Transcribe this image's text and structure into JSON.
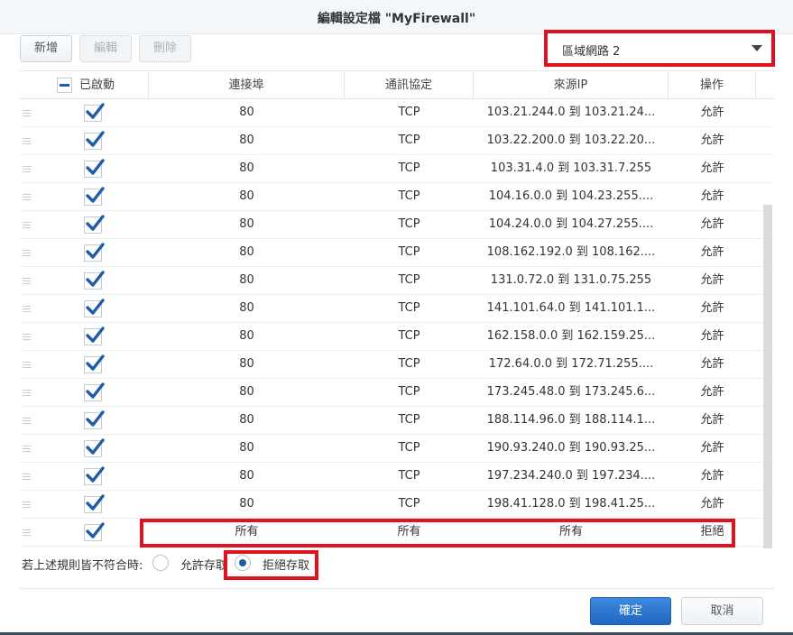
{
  "dialog": {
    "title": "編輯設定檔 \"MyFirewall\""
  },
  "toolbar": {
    "add_label": "新增",
    "edit_label": "編輯",
    "delete_label": "刪除"
  },
  "zone_select": {
    "value": "區域網路 2"
  },
  "columns": {
    "enabled": "已啟動",
    "port": "連接埠",
    "protocol": "通訊協定",
    "source_ip": "來源IP",
    "action": "操作"
  },
  "rules": [
    {
      "enabled": true,
      "port": "80",
      "protocol": "TCP",
      "source_ip": "103.21.244.0 到 103.21.24...",
      "action": "允許"
    },
    {
      "enabled": true,
      "port": "80",
      "protocol": "TCP",
      "source_ip": "103.22.200.0 到 103.22.20...",
      "action": "允許"
    },
    {
      "enabled": true,
      "port": "80",
      "protocol": "TCP",
      "source_ip": "103.31.4.0 到 103.31.7.255",
      "action": "允許"
    },
    {
      "enabled": true,
      "port": "80",
      "protocol": "TCP",
      "source_ip": "104.16.0.0 到 104.23.255....",
      "action": "允許"
    },
    {
      "enabled": true,
      "port": "80",
      "protocol": "TCP",
      "source_ip": "104.24.0.0 到 104.27.255....",
      "action": "允許"
    },
    {
      "enabled": true,
      "port": "80",
      "protocol": "TCP",
      "source_ip": "108.162.192.0 到 108.162....",
      "action": "允許"
    },
    {
      "enabled": true,
      "port": "80",
      "protocol": "TCP",
      "source_ip": "131.0.72.0 到 131.0.75.255",
      "action": "允許"
    },
    {
      "enabled": true,
      "port": "80",
      "protocol": "TCP",
      "source_ip": "141.101.64.0 到 141.101.1...",
      "action": "允許"
    },
    {
      "enabled": true,
      "port": "80",
      "protocol": "TCP",
      "source_ip": "162.158.0.0 到 162.159.25...",
      "action": "允許"
    },
    {
      "enabled": true,
      "port": "80",
      "protocol": "TCP",
      "source_ip": "172.64.0.0 到 172.71.255....",
      "action": "允許"
    },
    {
      "enabled": true,
      "port": "80",
      "protocol": "TCP",
      "source_ip": "173.245.48.0 到 173.245.6...",
      "action": "允許"
    },
    {
      "enabled": true,
      "port": "80",
      "protocol": "TCP",
      "source_ip": "188.114.96.0 到 188.114.1...",
      "action": "允許"
    },
    {
      "enabled": true,
      "port": "80",
      "protocol": "TCP",
      "source_ip": "190.93.240.0 到 190.93.25...",
      "action": "允許"
    },
    {
      "enabled": true,
      "port": "80",
      "protocol": "TCP",
      "source_ip": "197.234.240.0 到 197.234....",
      "action": "允許"
    },
    {
      "enabled": true,
      "port": "80",
      "protocol": "TCP",
      "source_ip": "198.41.128.0 到 198.41.25...",
      "action": "允許"
    },
    {
      "enabled": true,
      "port": "所有",
      "protocol": "所有",
      "source_ip": "所有",
      "action": "拒絕"
    }
  ],
  "no_match": {
    "question": "若上述規則皆不符合時:",
    "options": [
      "允許存取",
      "拒絕存取"
    ],
    "selected": 1
  },
  "footer": {
    "ok_label": "確定",
    "cancel_label": "取消"
  },
  "colors": {
    "highlight": "#e0121f",
    "primary": "#1f66c1",
    "check": "#1e5ba8"
  }
}
